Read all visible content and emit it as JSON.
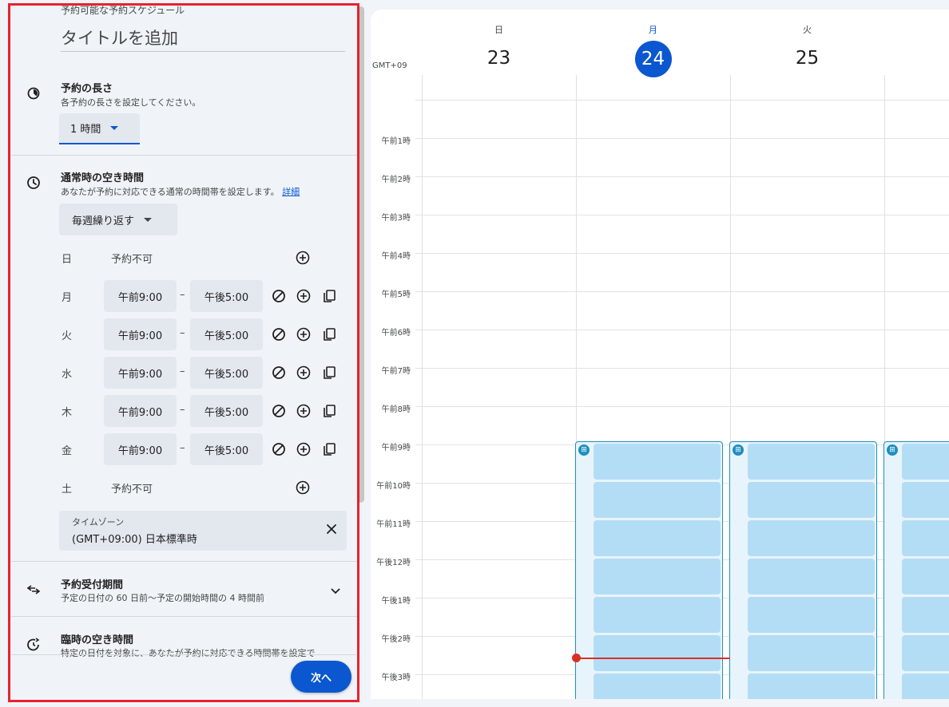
{
  "panel": {
    "header_label": "予約可能な予約スケジュール",
    "title_placeholder": "タイトルを追加",
    "duration": {
      "title": "予約の長さ",
      "subtitle": "各予約の長さを設定してください。",
      "value": "1 時間"
    },
    "availability": {
      "title": "通常時の空き時間",
      "subtitle": "あなたが予約に対応できる通常の時間帯を設定します。",
      "detail_link": "詳細",
      "repeat": "毎週繰り返す",
      "dash": "–",
      "unavailable": "予約不可",
      "days": [
        {
          "day": "日",
          "available": false
        },
        {
          "day": "月",
          "available": true,
          "start": "午前9:00",
          "end": "午後5:00"
        },
        {
          "day": "火",
          "available": true,
          "start": "午前9:00",
          "end": "午後5:00"
        },
        {
          "day": "水",
          "available": true,
          "start": "午前9:00",
          "end": "午後5:00"
        },
        {
          "day": "木",
          "available": true,
          "start": "午前9:00",
          "end": "午後5:00"
        },
        {
          "day": "金",
          "available": true,
          "start": "午前9:00",
          "end": "午後5:00"
        },
        {
          "day": "土",
          "available": false
        }
      ]
    },
    "timezone": {
      "label": "タイムゾーン",
      "value": "(GMT+09:00) 日本標準時"
    },
    "booking_window": {
      "title": "予約受付期間",
      "subtitle": "予定の日付の 60 日前〜予定の開始時間の 4 時間前"
    },
    "adjusted": {
      "title": "臨時の空き時間",
      "subtitle": "特定の日付を対象に、あなたが予約に対応できる時間帯を設定で"
    },
    "next_button": "次へ"
  },
  "calendar": {
    "timezone_label": "GMT+09",
    "days": [
      {
        "dow": "日",
        "date": "23",
        "today": false
      },
      {
        "dow": "月",
        "date": "24",
        "today": true
      },
      {
        "dow": "火",
        "date": "25",
        "today": false
      }
    ],
    "hours": [
      "午前1時",
      "午前2時",
      "午前3時",
      "午前4時",
      "午前5時",
      "午前6時",
      "午前7時",
      "午前8時",
      "午前9時",
      "午前10時",
      "午前11時",
      "午後12時",
      "午後1時",
      "午後2時",
      "午後3時"
    ]
  },
  "colors": {
    "accent": "#0b57d0",
    "slot_fill": "#b3ddf5",
    "slot_border": "#1e8fbf",
    "now_line": "#d93025",
    "highlight_box": "#e8222e"
  }
}
